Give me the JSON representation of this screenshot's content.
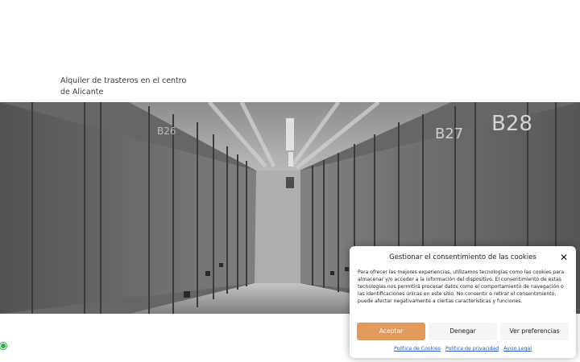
{
  "header": {
    "tagline": "Alquiler de trasteros en el centro de Alicante"
  },
  "hero": {
    "image_description_icon": "storage-corridor-photo",
    "unit_labels": [
      "B26",
      "B27",
      "B28"
    ]
  },
  "colors": {
    "accept": "#e29a5c",
    "link": "#2456c9",
    "whatsapp": "#2bb24c"
  },
  "cookie_banner": {
    "title": "Gestionar el consentimiento de las cookies",
    "close_icon": "close-icon",
    "body": "Para ofrecer las mejores experiencias, utilizamos tecnologías como las cookies para almacenar y/o acceder a la información del dispositivo. El consentimiento de estas tecnologías nos permitirá procesar datos como el comportamiento de navegación o las identificaciones únicas en este sitio. No consentir o retirar el consentimiento, puede afectar negativamente a ciertas características y funciones.",
    "buttons": {
      "accept": "Aceptar",
      "deny": "Denegar",
      "preferences": "Ver preferencias"
    },
    "links": {
      "cookies": "Política de Cookies",
      "privacy": "Política de privacidad",
      "legal": "Aviso Legal"
    }
  }
}
